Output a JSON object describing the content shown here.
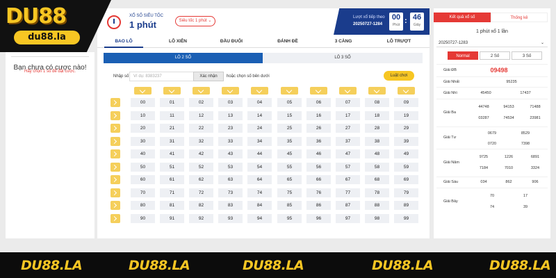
{
  "logo": {
    "main": "DU88",
    "sub": "du88.la"
  },
  "bet_slip": {
    "title": "Bạn chưa có cược nào!",
    "subtitle": "Hãy chọn 1 số để đặt cược."
  },
  "header": {
    "subtitle": "XỔ SỐ SIÊU TỐC",
    "title": "1 phút",
    "select": "Siêu tốc 1 phút ⌄",
    "next_label": "Lượt xổ tiếp theo",
    "next_code": "20250727-1284",
    "minutes": "00",
    "minutes_label": "Phút",
    "seconds": "46",
    "seconds_label": "Giây"
  },
  "tabs": [
    "BAO LÔ",
    "LÔ XIÊN",
    "ĐẦU ĐUÔI",
    "ĐÁNH ĐỀ",
    "3 CÀNG",
    "LÔ TRƯỢT"
  ],
  "subtabs": [
    "LÔ 2 SỐ",
    "LÔ 3 SỐ"
  ],
  "input": {
    "label": "Nhập số",
    "placeholder": "Ví dụ: 8383237",
    "confirm": "Xác nhận",
    "or_text": "hoặc chọn số bên dưới",
    "rules": "Luật chơi"
  },
  "numbers": [
    [
      "00",
      "01",
      "02",
      "03",
      "04",
      "05",
      "06",
      "07",
      "08",
      "09"
    ],
    [
      "10",
      "11",
      "12",
      "13",
      "14",
      "15",
      "16",
      "17",
      "18",
      "19"
    ],
    [
      "20",
      "21",
      "22",
      "23",
      "24",
      "25",
      "26",
      "27",
      "28",
      "29"
    ],
    [
      "30",
      "31",
      "32",
      "33",
      "34",
      "35",
      "36",
      "37",
      "38",
      "39"
    ],
    [
      "40",
      "41",
      "42",
      "43",
      "44",
      "45",
      "46",
      "47",
      "48",
      "49"
    ],
    [
      "50",
      "51",
      "52",
      "53",
      "54",
      "55",
      "56",
      "57",
      "58",
      "59"
    ],
    [
      "60",
      "61",
      "62",
      "63",
      "64",
      "65",
      "66",
      "67",
      "68",
      "69"
    ],
    [
      "70",
      "71",
      "72",
      "73",
      "74",
      "75",
      "76",
      "77",
      "78",
      "79"
    ],
    [
      "80",
      "81",
      "82",
      "83",
      "84",
      "85",
      "86",
      "87",
      "88",
      "89"
    ],
    [
      "90",
      "91",
      "92",
      "93",
      "94",
      "95",
      "96",
      "97",
      "98",
      "99"
    ]
  ],
  "results": {
    "tabs": [
      "Kết quả xổ số",
      "Thống kê"
    ],
    "title": "1 phút xổ 1 lần",
    "draw": "20250727-1283",
    "modes": [
      "Normal",
      "2 Số",
      "3 Số"
    ],
    "prizes": [
      {
        "label": "Giải ĐB",
        "values": [
          "09498"
        ]
      },
      {
        "label": "Giải Nhất",
        "values": [
          "95235"
        ]
      },
      {
        "label": "Giải Nhì",
        "values": [
          "45450",
          "17437"
        ]
      },
      {
        "label": "Giải Ba",
        "values": [
          "44748",
          "94153",
          "71488",
          "03287",
          "74534",
          "23981"
        ]
      },
      {
        "label": "Giải Tư",
        "values": [
          "0679",
          "8529",
          "0720",
          "7398"
        ]
      },
      {
        "label": "Giải Năm",
        "values": [
          "9725",
          "1226",
          "6891",
          "7184",
          "7010",
          "3324"
        ]
      },
      {
        "label": "Giải Sáu",
        "values": [
          "034",
          "862",
          "906"
        ]
      },
      {
        "label": "Giải Bảy",
        "values": [
          "70",
          "17",
          "74",
          "39"
        ]
      }
    ]
  },
  "footer": [
    "DU88.LA",
    "DU88.LA",
    "DU88.LA",
    "DU88.LA",
    "DU88.LA"
  ],
  "colors": {
    "brand_yellow": "#f7c623",
    "navy": "#1a3c8c",
    "red": "#e53935",
    "blue": "#1a5fb4"
  }
}
